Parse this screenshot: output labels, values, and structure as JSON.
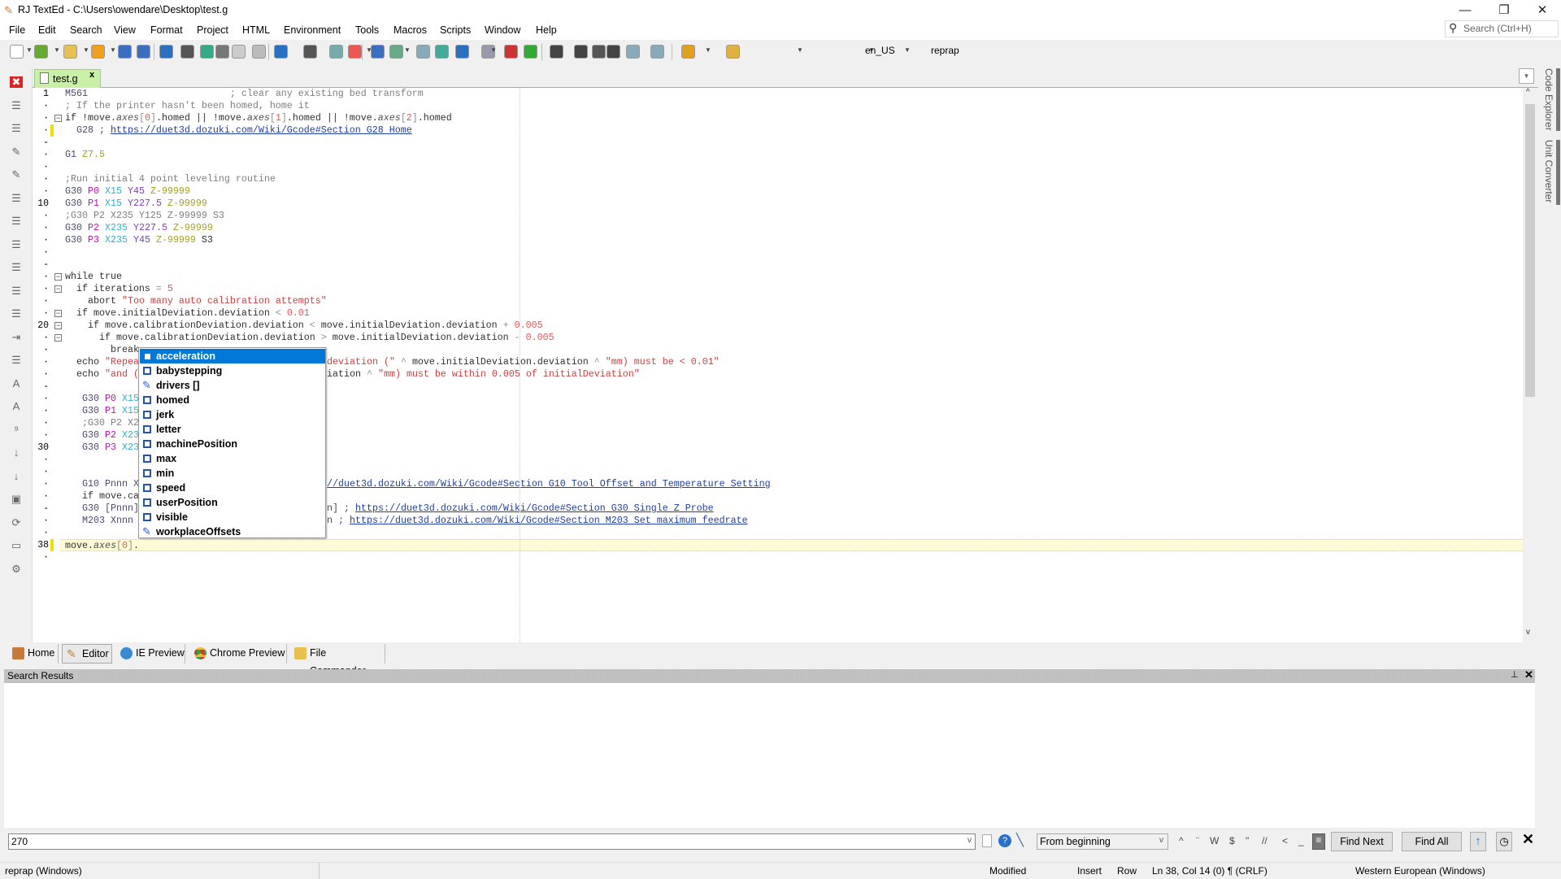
{
  "window": {
    "title": "RJ TextEd - C:\\Users\\owendare\\Desktop\\test.g",
    "controls": [
      "minimize",
      "restore",
      "close"
    ]
  },
  "menu": [
    "File",
    "Edit",
    "Search",
    "View",
    "Format",
    "Project",
    "HTML",
    "Environment",
    "Tools",
    "Macros",
    "Scripts",
    "Window",
    "Help"
  ],
  "global_search": {
    "placeholder": "Search (Ctrl+H)"
  },
  "toolbar": {
    "icons": [
      "new-file",
      "open",
      "open-project",
      "favorites",
      "save",
      "save-all",
      "undo",
      "redo",
      "sync",
      "cut",
      "copy",
      "paste",
      "back",
      "forward",
      "find",
      "replace",
      "book",
      "globe",
      "page",
      "preview",
      "sum",
      "print",
      "tools",
      "plugin",
      "run",
      "run-script",
      "record",
      "stop",
      "grid",
      "columns",
      "spellcheck",
      "highlighter"
    ],
    "spell_lang": "en_US",
    "syntax": "reprap"
  },
  "tab": {
    "label": "test.g"
  },
  "side_panels": [
    "Code Explorer",
    "Unit Converter"
  ],
  "editor": {
    "lines": [
      {
        "g": "1",
        "t": [
          [
            "M561",
            "g"
          ],
          [
            "                         ; clear any existing bed transform",
            "c"
          ]
        ]
      },
      {
        "g": "·",
        "t": [
          [
            "; If the printer hasn't been homed, home it",
            "c"
          ]
        ]
      },
      {
        "g": "·",
        "f": 1,
        "t": [
          [
            "if !move.",
            "k"
          ],
          [
            "axes",
            "i"
          ],
          [
            "[",
            "o"
          ],
          [
            "0",
            "n"
          ],
          [
            "]",
            "o"
          ],
          [
            ".homed || !move.",
            "k"
          ],
          [
            "axes",
            "i"
          ],
          [
            "[",
            "o"
          ],
          [
            "1",
            "n"
          ],
          [
            "]",
            "o"
          ],
          [
            ".homed || !move.",
            "k"
          ],
          [
            "axes",
            "i"
          ],
          [
            "[",
            "o"
          ],
          [
            "2",
            "n"
          ],
          [
            "]",
            "o"
          ],
          [
            ".homed",
            "k"
          ]
        ]
      },
      {
        "g": "·",
        "m": 1,
        "t": [
          [
            "  G28 ; ",
            "g"
          ],
          [
            "https://duet3d.dozuki.com/Wiki/Gcode#Section G28 Home",
            "l"
          ]
        ]
      },
      {
        "g": "-",
        "t": []
      },
      {
        "g": "·",
        "t": [
          [
            "G1 ",
            "g"
          ],
          [
            "Z7.5",
            "z"
          ]
        ]
      },
      {
        "g": "·",
        "t": []
      },
      {
        "g": "·",
        "t": [
          [
            ";Run initial 4 point leveling routine",
            "c"
          ]
        ]
      },
      {
        "g": "·",
        "t": [
          [
            "G30 ",
            "g"
          ],
          [
            "P0 ",
            "p"
          ],
          [
            "X15 ",
            "x"
          ],
          [
            "Y45 ",
            "y"
          ],
          [
            "Z-99999",
            "z"
          ]
        ]
      },
      {
        "g": "10",
        "t": [
          [
            "G30 ",
            "g"
          ],
          [
            "P1 ",
            "p"
          ],
          [
            "X15 ",
            "x"
          ],
          [
            "Y227.5 ",
            "y"
          ],
          [
            "Z-99999",
            "z"
          ]
        ]
      },
      {
        "g": "·",
        "t": [
          [
            ";G30 P2 X235 Y125 Z-99999 S3",
            "c"
          ]
        ]
      },
      {
        "g": "·",
        "t": [
          [
            "G30 ",
            "g"
          ],
          [
            "P2 ",
            "p"
          ],
          [
            "X235 ",
            "x"
          ],
          [
            "Y227.5 ",
            "y"
          ],
          [
            "Z-99999",
            "z"
          ]
        ]
      },
      {
        "g": "·",
        "t": [
          [
            "G30 ",
            "g"
          ],
          [
            "P3 ",
            "p"
          ],
          [
            "X235 ",
            "x"
          ],
          [
            "Y45 ",
            "y"
          ],
          [
            "Z-99999 ",
            "z"
          ],
          [
            "S3",
            "k"
          ]
        ]
      },
      {
        "g": "·",
        "t": []
      },
      {
        "g": "-",
        "t": []
      },
      {
        "g": "·",
        "f": 1,
        "t": [
          [
            "while true",
            "k"
          ]
        ]
      },
      {
        "g": "·",
        "f": 1,
        "t": [
          [
            "  if iterations ",
            "k"
          ],
          [
            "= ",
            "o"
          ],
          [
            "5",
            "n"
          ]
        ]
      },
      {
        "g": "·",
        "t": [
          [
            "    abort ",
            "k"
          ],
          [
            "\"Too many auto calibration attempts\"",
            "s"
          ]
        ]
      },
      {
        "g": "·",
        "f": 1,
        "t": [
          [
            "  if move.initialDeviation.deviation ",
            "k"
          ],
          [
            "< ",
            "o"
          ],
          [
            "0.01",
            "n"
          ]
        ]
      },
      {
        "g": "20",
        "f": 1,
        "t": [
          [
            "    if move.calibrationDeviation.deviation ",
            "k"
          ],
          [
            "< ",
            "o"
          ],
          [
            "move.initialDeviation.deviation ",
            "k"
          ],
          [
            "+ ",
            "o"
          ],
          [
            "0.005",
            "n"
          ]
        ]
      },
      {
        "g": "·",
        "f": 1,
        "t": [
          [
            "      if move.calibrationDeviation.deviation ",
            "k"
          ],
          [
            "> ",
            "o"
          ],
          [
            "move.initialDeviation.deviation ",
            "k"
          ],
          [
            "- ",
            "o"
          ],
          [
            "0.005",
            "n"
          ]
        ]
      },
      {
        "g": "·",
        "t": [
          [
            "        break",
            "k"
          ]
        ]
      },
      {
        "g": "·",
        "t": [
          [
            "  echo ",
            "k"
          ],
          [
            "\"Repea",
            "s"
          ]
        ],
        "r": [
          [
            "deviation (\" ",
            "s"
          ],
          [
            "^ ",
            "o"
          ],
          [
            "move.initialDeviation.deviation ",
            "k"
          ],
          [
            "^ ",
            "o"
          ],
          [
            "\"mm) must be < 0.01\"",
            "s"
          ]
        ]
      },
      {
        "g": "·",
        "t": [
          [
            "  echo ",
            "k"
          ],
          [
            "\"and (",
            "s"
          ]
        ],
        "r": [
          [
            "iation ",
            "k"
          ],
          [
            "^ ",
            "o"
          ],
          [
            "\"mm) must be within 0.005 of initialDeviation\"",
            "s"
          ]
        ]
      },
      {
        "g": "-",
        "t": []
      },
      {
        "g": "·",
        "t": [
          [
            "   G30 ",
            "g"
          ],
          [
            "P0 ",
            "p"
          ],
          [
            "X15",
            "x"
          ]
        ]
      },
      {
        "g": "·",
        "t": [
          [
            "   G30 ",
            "g"
          ],
          [
            "P1 ",
            "p"
          ],
          [
            "X15",
            "x"
          ]
        ]
      },
      {
        "g": "·",
        "t": [
          [
            "   ;G30 P2 X2",
            "c"
          ]
        ]
      },
      {
        "g": "·",
        "t": [
          [
            "   G30 ",
            "g"
          ],
          [
            "P2 ",
            "p"
          ],
          [
            "X23",
            "x"
          ]
        ]
      },
      {
        "g": "30",
        "t": [
          [
            "   G30 ",
            "g"
          ],
          [
            "P3 ",
            "p"
          ],
          [
            "X23",
            "x"
          ]
        ]
      },
      {
        "g": "·",
        "t": []
      },
      {
        "g": "·",
        "t": []
      },
      {
        "g": "·",
        "t": [
          [
            "   G10 Pnnn X",
            "g"
          ]
        ],
        "r": [
          [
            "//duet3d.dozuki.com/Wiki/Gcode#Section G10 Tool Offset and Temperature Setting",
            "l"
          ]
        ]
      },
      {
        "g": "·",
        "t": [
          [
            "   if move.ca",
            "k"
          ]
        ]
      },
      {
        "g": "-",
        "t": [
          [
            "   G30 [Pnnn]",
            "g"
          ]
        ],
        "r": [
          [
            "n] ; ",
            "g"
          ],
          [
            "https://duet3d.dozuki.com/Wiki/Gcode#Section G30 Single Z Probe",
            "l"
          ]
        ]
      },
      {
        "g": "·",
        "t": [
          [
            "   M203 Xnnn",
            "g"
          ]
        ],
        "r": [
          [
            "n ; ",
            "g"
          ],
          [
            "https://duet3d.dozuki.com/Wiki/Gcode#Section M203 Set maximum feedrate",
            "l"
          ]
        ]
      },
      {
        "g": "·",
        "t": []
      },
      {
        "g": "38",
        "m": 1,
        "cur": 1,
        "t": [
          [
            "move.",
            "k"
          ],
          [
            "axes",
            "i"
          ],
          [
            "[",
            "o"
          ],
          [
            "0",
            "n"
          ],
          [
            "]",
            "o"
          ],
          [
            ".",
            "k"
          ]
        ]
      },
      {
        "g": "·",
        "t": []
      }
    ]
  },
  "autocomplete": {
    "items": [
      {
        "label": "acceleration",
        "kind": "property",
        "selected": true
      },
      {
        "label": "babystepping",
        "kind": "property"
      },
      {
        "label": "drivers []",
        "kind": "array"
      },
      {
        "label": "homed",
        "kind": "property"
      },
      {
        "label": "jerk",
        "kind": "property"
      },
      {
        "label": "letter",
        "kind": "property"
      },
      {
        "label": "machinePosition",
        "kind": "property"
      },
      {
        "label": "max",
        "kind": "property"
      },
      {
        "label": "min",
        "kind": "property"
      },
      {
        "label": "speed",
        "kind": "property"
      },
      {
        "label": "userPosition",
        "kind": "property"
      },
      {
        "label": "visible",
        "kind": "property"
      },
      {
        "label": "workplaceOffsets",
        "kind": "array"
      }
    ],
    "accent": "#0078d7"
  },
  "bottom_tabs": [
    {
      "label": "Home",
      "icon": "home"
    },
    {
      "label": "Editor",
      "icon": "pencil",
      "active": true
    },
    {
      "label": "IE Preview",
      "icon": "ie"
    },
    {
      "label": "Chrome Preview",
      "icon": "chrome"
    },
    {
      "label": "File Commander",
      "icon": "folders"
    }
  ],
  "search_results": {
    "title": "Search Results"
  },
  "find": {
    "value": "270",
    "origin": "From beginning",
    "options": [
      "^",
      "¨",
      "W",
      "$",
      "\"",
      "//",
      "<",
      "_",
      "≡"
    ],
    "find_next": "Find Next",
    "find_all": "Find All"
  },
  "status": {
    "mode": "reprap (Windows)",
    "modified": "Modified",
    "insert": "Insert",
    "row": "Row",
    "position": "Ln 38, Col 14 (0) ¶ (CRLF)",
    "encoding": "Western European (Windows)"
  }
}
